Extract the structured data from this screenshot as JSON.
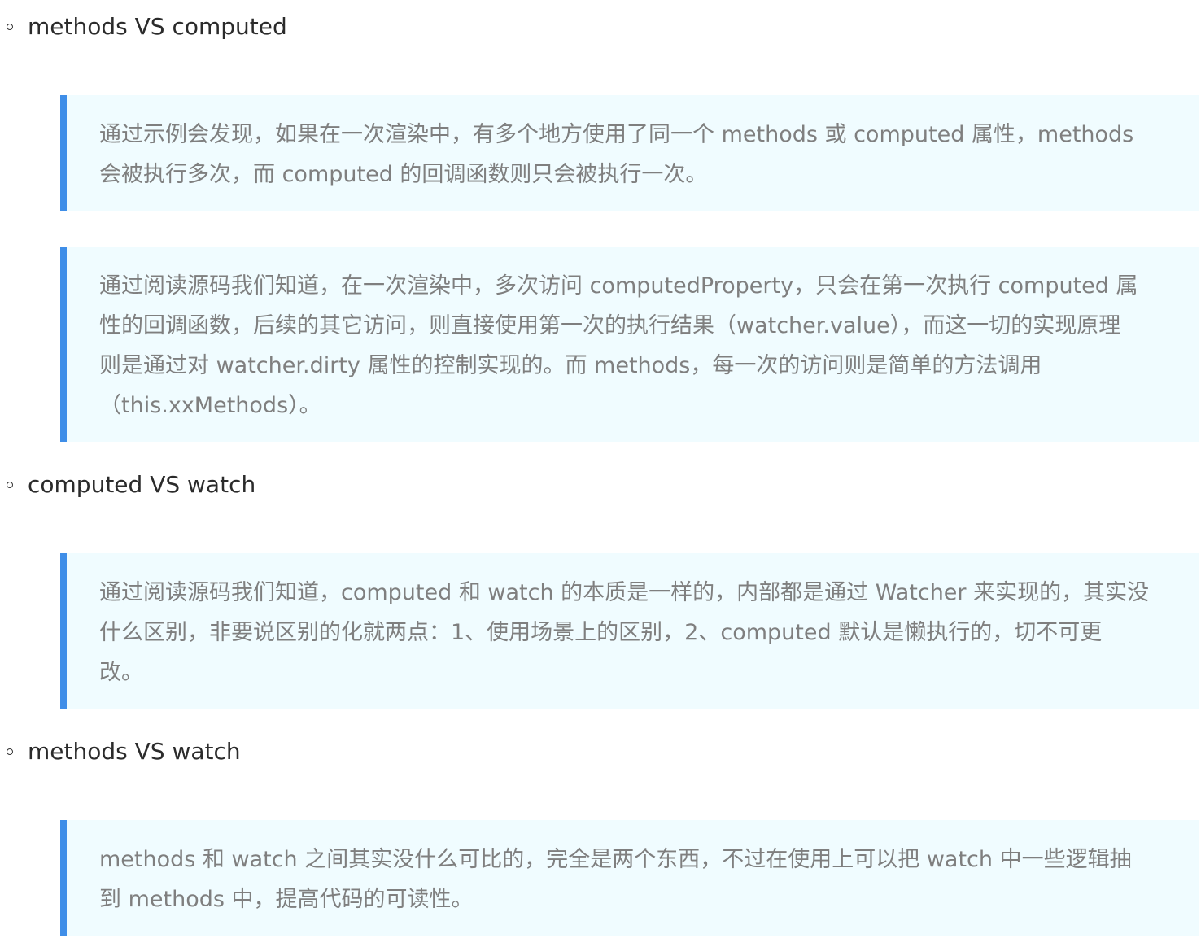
{
  "sections": [
    {
      "title": "methods VS computed",
      "quotes": [
        "通过示例会发现，如果在一次渲染中，有多个地方使用了同一个 methods 或 computed 属性，methods\n会被执行多次，而 computed 的回调函数则只会被执行一次。",
        "通过阅读源码我们知道，在一次渲染中，多次访问 computedProperty，只会在第一次执行 computed 属\n性的回调函数，后续的其它访问，则直接使用第一次的执行结果（watcher.value），而这一切的实现原理\n则是通过对 watcher.dirty 属性的控制实现的。而 methods，每一次的访问则是简单的方法调用\n（this.xxMethods）。"
      ]
    },
    {
      "title": "computed VS watch",
      "quotes": [
        "通过阅读源码我们知道，computed 和 watch 的本质是一样的，内部都是通过 Watcher 来实现的，其实没\n什么区别，非要说区别的化就两点：1、使用场景上的区别，2、computed 默认是懒执行的，切不可更\n改。"
      ]
    },
    {
      "title": "methods VS watch",
      "quotes": [
        "methods 和 watch 之间其实没什么可比的，完全是两个东西，不过在使用上可以把 watch 中一些逻辑抽\n到 methods 中，提高代码的可读性。"
      ]
    }
  ],
  "colors": {
    "quote_background": "#f0fcff",
    "quote_border": "#3f8ee8",
    "quote_text": "#7f7f7f",
    "heading_text": "#2b2b2b"
  }
}
